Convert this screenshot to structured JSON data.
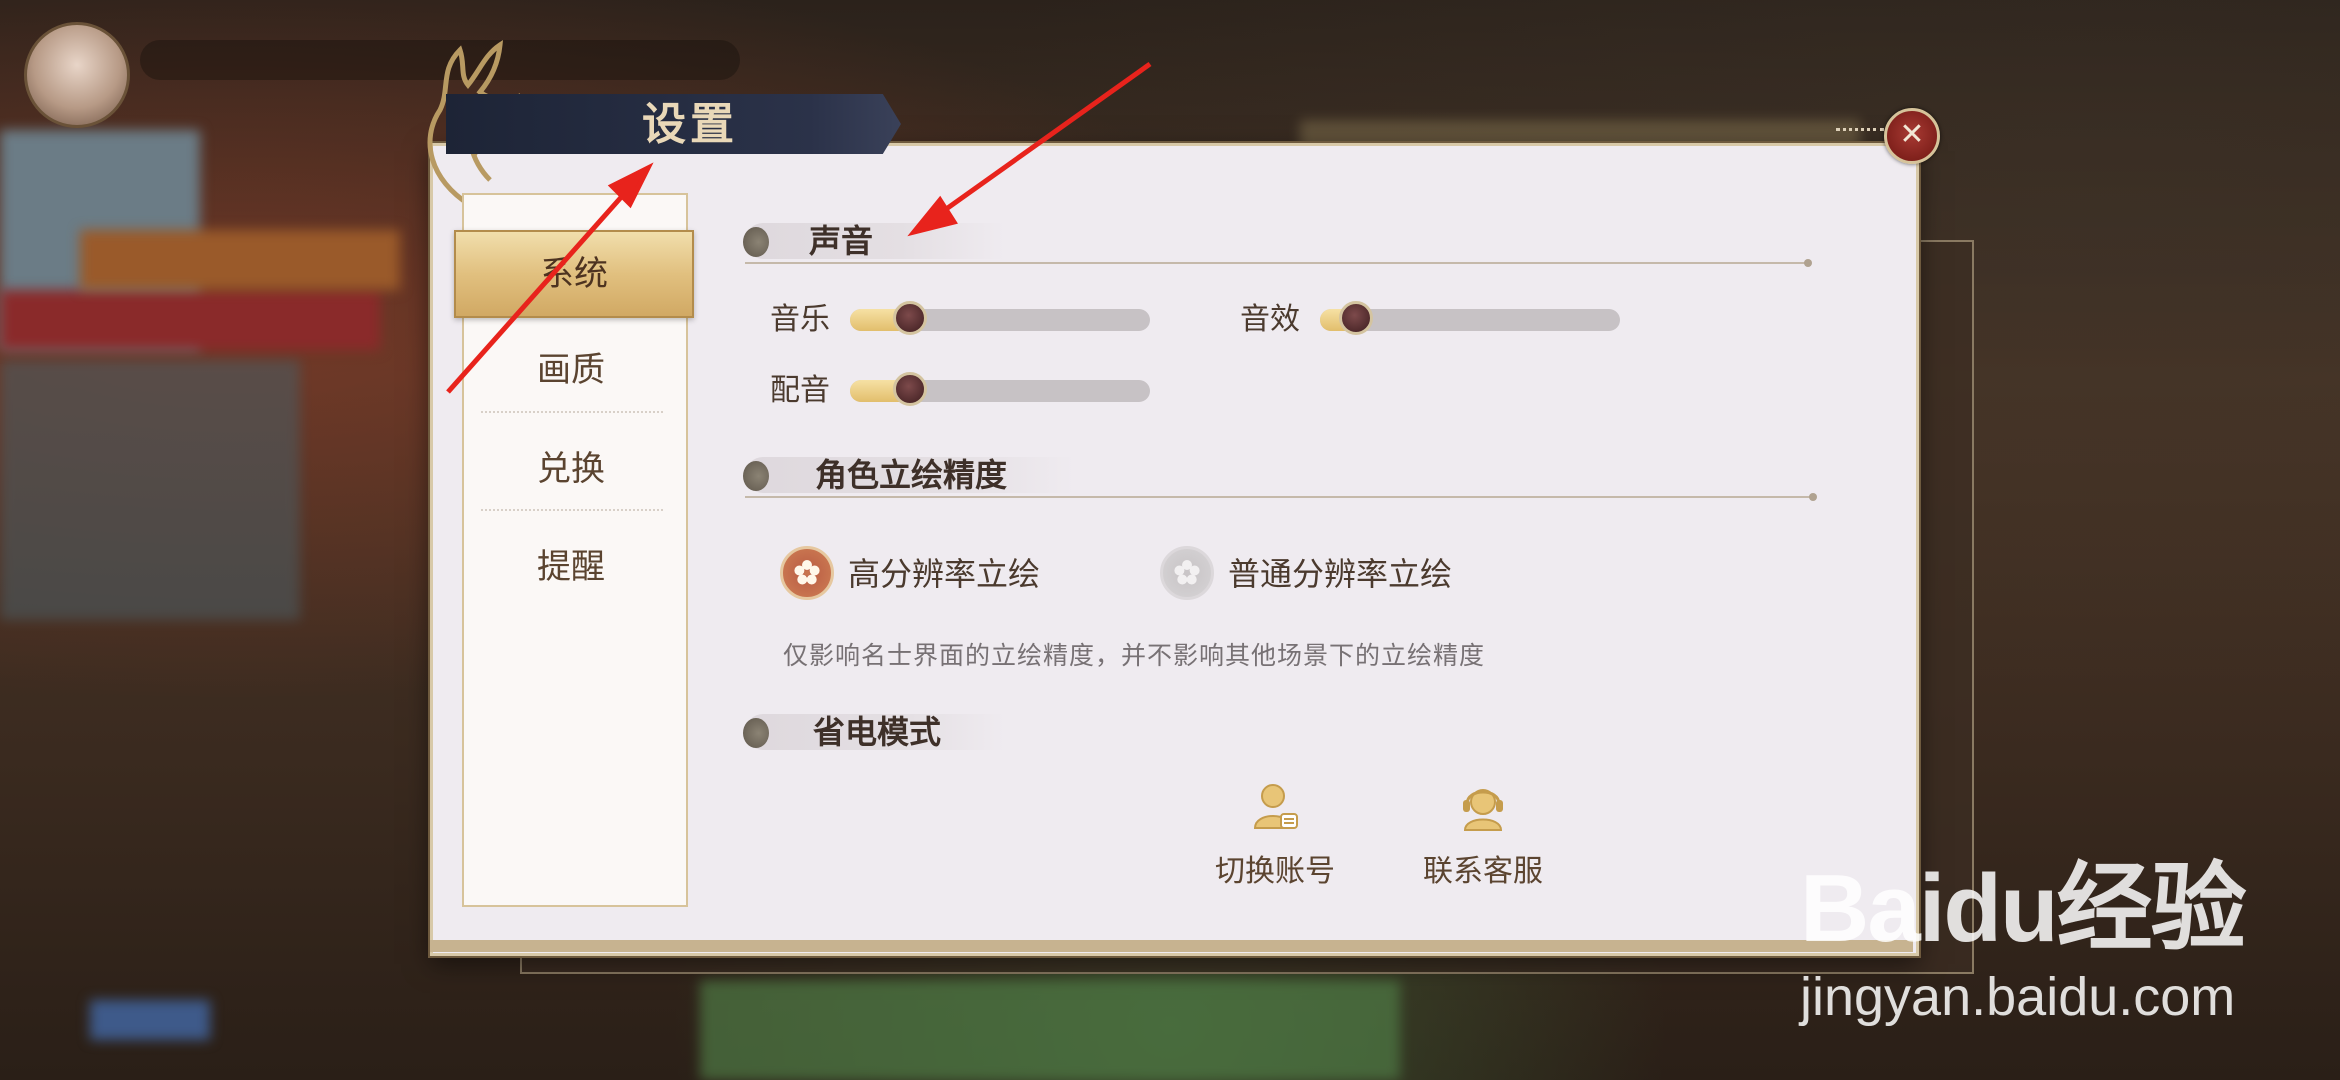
{
  "dialog": {
    "title": "设置",
    "close_symbol": "✕"
  },
  "sidebar": {
    "items": [
      {
        "label": "系统",
        "active": true
      },
      {
        "label": "画质",
        "active": false
      },
      {
        "label": "兑换",
        "active": false
      },
      {
        "label": "提醒",
        "active": false
      }
    ]
  },
  "sound": {
    "heading": "声音",
    "sliders": [
      {
        "label": "音乐",
        "level": 0.2
      },
      {
        "label": "音效",
        "level": 0.12
      },
      {
        "label": "配音",
        "level": 0.2
      }
    ]
  },
  "portrait": {
    "heading": "角色立绘精度",
    "options": [
      {
        "label": "高分辨率立绘",
        "selected": true
      },
      {
        "label": "普通分辨率立绘",
        "selected": false
      }
    ],
    "note": "仅影响名士界面的立绘精度，并不影响其他场景下的立绘精度"
  },
  "power_saving": {
    "heading": "省电模式"
  },
  "actions": {
    "switch_account": "切换账号",
    "contact_service": "联系客服"
  },
  "watermark": {
    "logo": "Baidu经验",
    "url": "jingyan.baidu.com"
  },
  "colors": {
    "accent_gold": "#e2be6c",
    "close_red": "#7d1f1a",
    "annotation_red": "#e8231c"
  }
}
